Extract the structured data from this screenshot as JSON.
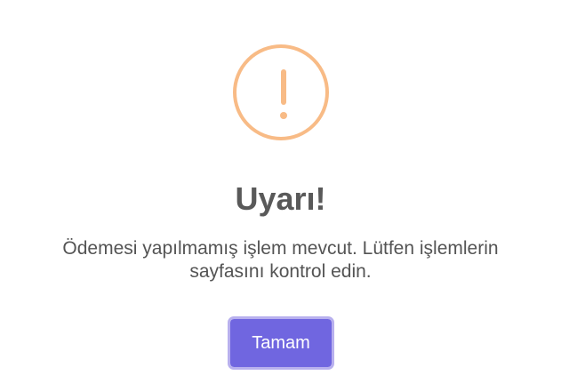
{
  "dialog": {
    "icon": "warning-icon",
    "title": "Uyarı!",
    "message": "Ödemesi yapılmamış işlem mevcut. Lütfen işlemlerin sayfasını kontrol edin.",
    "confirm_label": "Tamam"
  },
  "colors": {
    "icon": "#f8bb86",
    "title": "#595959",
    "message": "#545454",
    "button": "#7066e0",
    "button_focus_ring": "#b8b0ee"
  }
}
